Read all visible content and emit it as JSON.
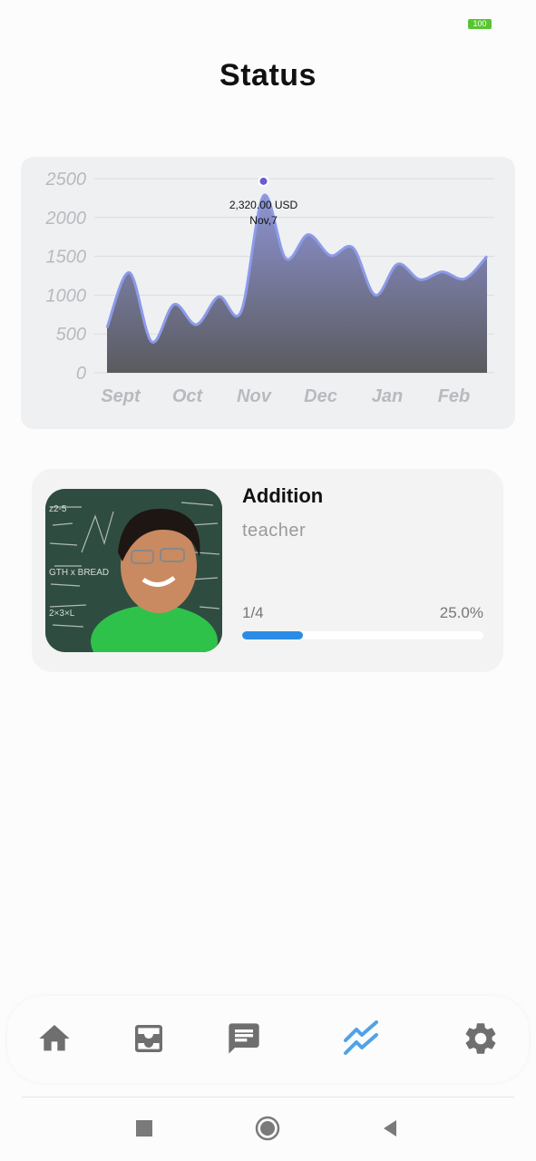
{
  "status_bar": {
    "battery": "100"
  },
  "header": {
    "title": "Status"
  },
  "chart_data": {
    "type": "area",
    "x_labels": [
      "Sept",
      "Oct",
      "Nov",
      "Dec",
      "Jan",
      "Feb"
    ],
    "y_ticks": [
      "2500",
      "2000",
      "1500",
      "1000",
      "500",
      "0"
    ],
    "ylim": [
      0,
      2500
    ],
    "grid": true,
    "series": [
      {
        "values": [
          580,
          1290,
          400,
          880,
          620,
          980,
          790,
          2280,
          1470,
          1780,
          1510,
          1610,
          1000,
          1400,
          1200,
          1300,
          1210,
          1500
        ]
      }
    ],
    "highlight": {
      "index": 7,
      "value_label": "2,320.00 USD",
      "date_label": "Nov,7"
    },
    "colors": {
      "line": "#8c9ae8",
      "fill_top": "#8e94d3",
      "fill_bottom": "#5a5a5e",
      "point": "#6b5dcc"
    }
  },
  "course": {
    "title": "Addition",
    "role": "teacher",
    "progress_count": "1/4",
    "progress_percent": "25.0%",
    "progress_fraction": 0.25,
    "image_alt": "student in front of chalkboard"
  },
  "bottom_nav": {
    "items": [
      {
        "icon": "home-icon"
      },
      {
        "icon": "inbox-icon"
      },
      {
        "icon": "chat-icon"
      },
      {
        "icon": "trending-icon",
        "active": true
      },
      {
        "icon": "gear-icon"
      }
    ],
    "active_color": "#4ea3e8",
    "inactive_color": "#6f6f6f"
  },
  "system_nav": {
    "buttons": [
      "recents-button",
      "home-button",
      "back-button"
    ]
  }
}
